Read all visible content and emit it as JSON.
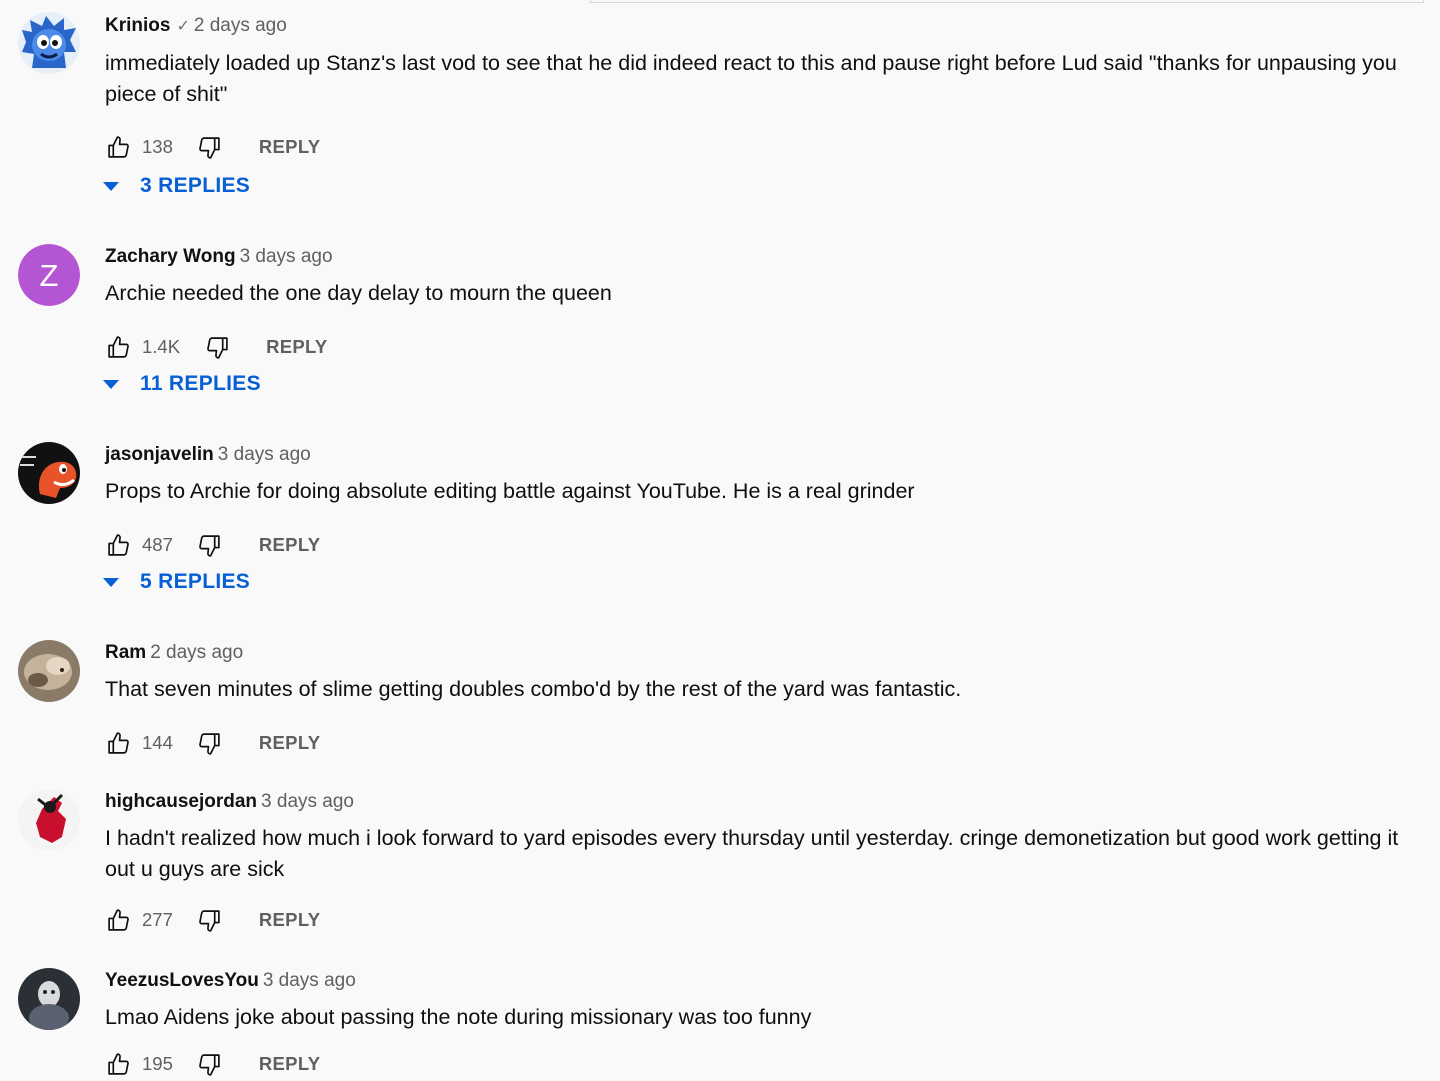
{
  "comments": [
    {
      "author": "Krinios",
      "verified": "✓",
      "time": "2 days ago",
      "text": "immediately loaded up Stanz's last vod to see that he did indeed react to this and pause right before Lud said \"thanks for unpausing you piece of shit\"",
      "likes": "138",
      "reply_label": "REPLY",
      "replies_label": "3 REPLIES",
      "avatar": "blue-character-avatar"
    },
    {
      "author": "Zachary Wong",
      "time": "3 days ago",
      "text": "Archie needed the one day delay to mourn the queen",
      "likes": "1.4K",
      "reply_label": "REPLY",
      "replies_label": "11 REPLIES",
      "avatar_letter": "Z",
      "avatar_color": "#b455d4"
    },
    {
      "author": "jasonjavelin",
      "time": "3 days ago",
      "text": "Props to Archie for doing absolute editing battle against YouTube. He is a real grinder",
      "likes": "487",
      "reply_label": "REPLY",
      "replies_label": "5 REPLIES",
      "avatar": "orange-dino-avatar"
    },
    {
      "author": "Ram",
      "time": "2 days ago",
      "text": "That seven minutes of slime getting doubles combo'd by the rest of the yard was fantastic.",
      "likes": "144",
      "reply_label": "REPLY",
      "avatar": "photo-avatar"
    },
    {
      "author": "highcausejordan",
      "time": "3 days ago",
      "text": "I hadn't realized how much i look forward to yard episodes every thursday until yesterday. cringe demonetization but good work getting it out u guys are sick",
      "likes": "277",
      "reply_label": "REPLY",
      "avatar": "red-figure-avatar"
    },
    {
      "author": "YeezusLovesYou",
      "time": "3 days ago",
      "text": "Lmao Aidens joke about passing the note during missionary was too funny",
      "likes": "195",
      "reply_label": "REPLY",
      "avatar": "dark-photo-avatar"
    }
  ],
  "colors": {
    "link": "#065fd4",
    "meta": "#606060",
    "background": "#f9f9f9"
  }
}
